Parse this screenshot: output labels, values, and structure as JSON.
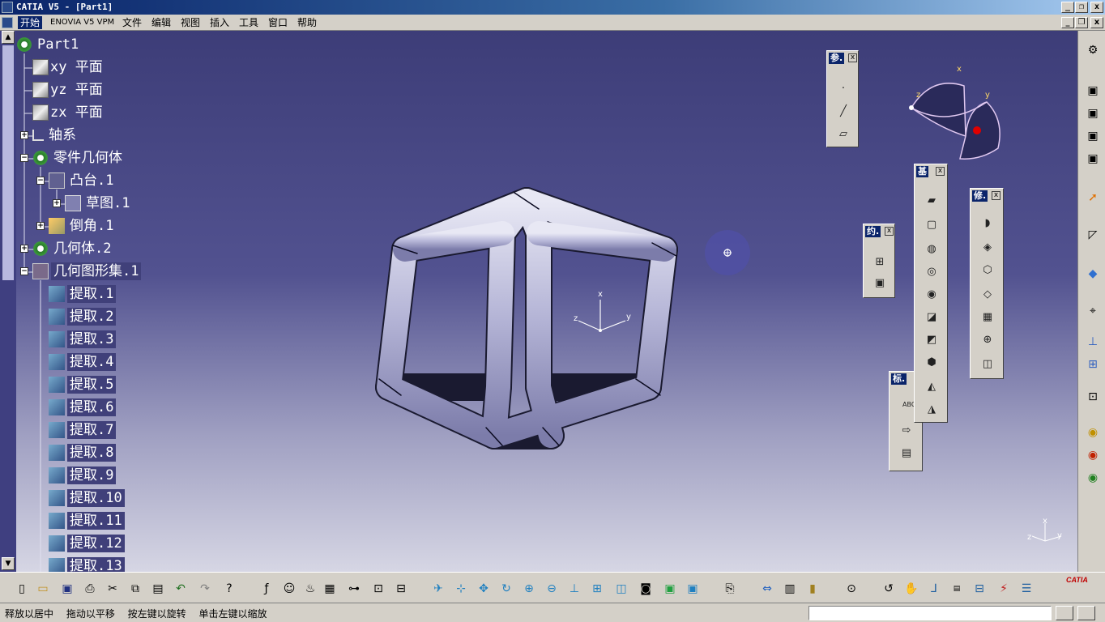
{
  "window": {
    "title": "CATIA V5 - [Part1]",
    "buttons": {
      "minimize": "_",
      "restore": "❐",
      "close": "x"
    }
  },
  "menu": {
    "items": [
      "开始",
      "ENOVIA V5 VPM",
      "文件",
      "编辑",
      "视图",
      "插入",
      "工具",
      "窗口",
      "帮助"
    ]
  },
  "tree": {
    "root": "Part1",
    "nodes": [
      {
        "label": "xy 平面"
      },
      {
        "label": "yz 平面"
      },
      {
        "label": "zx 平面"
      },
      {
        "label": "轴系"
      },
      {
        "label": "零件几何体"
      },
      {
        "label": "凸台.1"
      },
      {
        "label": "草图.1"
      },
      {
        "label": "倒角.1"
      },
      {
        "label": "几何体.2"
      },
      {
        "label": "几何图形集.1"
      },
      {
        "label": "提取.1"
      },
      {
        "label": "提取.2"
      },
      {
        "label": "提取.3"
      },
      {
        "label": "提取.4"
      },
      {
        "label": "提取.5"
      },
      {
        "label": "提取.6"
      },
      {
        "label": "提取.7"
      },
      {
        "label": "提取.8"
      },
      {
        "label": "提取.9"
      },
      {
        "label": "提取.10"
      },
      {
        "label": "提取.11"
      },
      {
        "label": "提取.12"
      },
      {
        "label": "提取.13"
      }
    ]
  },
  "toolbars": {
    "ref": {
      "title": "参.",
      "close": "x"
    },
    "constraint": {
      "title": "约.",
      "close": "x"
    },
    "base": {
      "title": "基",
      "close": "x"
    },
    "modify": {
      "title": "修.",
      "close": "x"
    },
    "annotation": {
      "title": "标.",
      "text": "ABC"
    }
  },
  "compass": {
    "x": "x",
    "y": "y",
    "z": "z"
  },
  "axes": {
    "x": "x",
    "y": "y",
    "z": "z"
  },
  "status": {
    "message": "释放以居中　 拖动以平移　 按左键以旋转　 单击左键以缩放",
    "command_value": ""
  },
  "brand": "CATIA",
  "colors": {
    "background_top": "#3d3d78",
    "background_bottom": "#d6d6e4",
    "model": "#b4b4d6",
    "selection": "#40407a"
  }
}
